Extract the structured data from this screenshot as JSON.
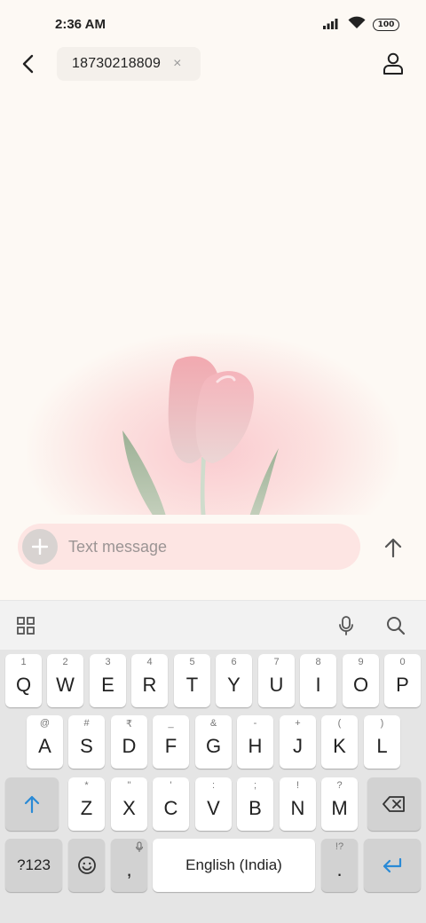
{
  "status_bar": {
    "time": "2:36 AM",
    "battery": "100",
    "icons": [
      "signal-icon",
      "wifi-icon",
      "battery-icon"
    ]
  },
  "header": {
    "recipient": "18730218809",
    "chip_close": "×"
  },
  "composer": {
    "placeholder": "Text message"
  },
  "keyboard": {
    "row1": [
      {
        "hint": "1",
        "label": "Q"
      },
      {
        "hint": "2",
        "label": "W"
      },
      {
        "hint": "3",
        "label": "E"
      },
      {
        "hint": "4",
        "label": "R"
      },
      {
        "hint": "5",
        "label": "T"
      },
      {
        "hint": "6",
        "label": "Y"
      },
      {
        "hint": "7",
        "label": "U"
      },
      {
        "hint": "8",
        "label": "I"
      },
      {
        "hint": "9",
        "label": "O"
      },
      {
        "hint": "0",
        "label": "P"
      }
    ],
    "row2": [
      {
        "hint": "@",
        "label": "A"
      },
      {
        "hint": "#",
        "label": "S"
      },
      {
        "hint": "₹",
        "label": "D"
      },
      {
        "hint": "_",
        "label": "F"
      },
      {
        "hint": "&",
        "label": "G"
      },
      {
        "hint": "-",
        "label": "H"
      },
      {
        "hint": "+",
        "label": "J"
      },
      {
        "hint": "(",
        "label": "K"
      },
      {
        "hint": ")",
        "label": "L"
      }
    ],
    "row3": [
      {
        "hint": "*",
        "label": "Z"
      },
      {
        "hint": "\"",
        "label": "X"
      },
      {
        "hint": "'",
        "label": "C"
      },
      {
        "hint": ":",
        "label": "V"
      },
      {
        "hint": ";",
        "label": "B"
      },
      {
        "hint": "!",
        "label": "N"
      },
      {
        "hint": "?",
        "label": "M"
      }
    ],
    "symbols_key": "?123",
    "comma_key": ",",
    "space_key": "English (India)",
    "period_hint": "!?",
    "period_key": ".",
    "accent_color": "#2a8ad6"
  }
}
